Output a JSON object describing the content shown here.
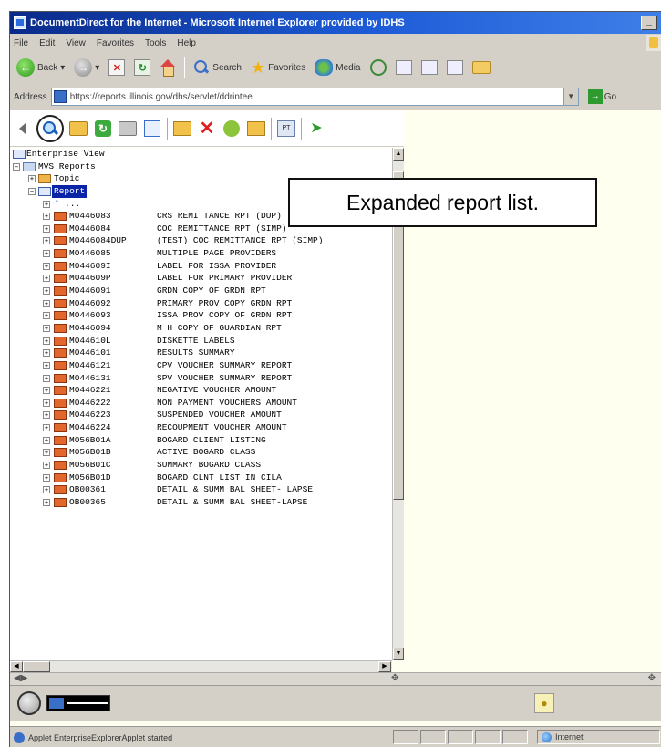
{
  "window": {
    "title": "DocumentDirect for the Internet - Microsoft Internet Explorer provided by IDHS",
    "min_glyph": "_"
  },
  "menubar": [
    "File",
    "Edit",
    "View",
    "Favorites",
    "Tools",
    "Help"
  ],
  "toolbar": {
    "back": "Back",
    "search": "Search",
    "favorites": "Favorites",
    "media": "Media"
  },
  "address": {
    "label": "Address",
    "url": "https://reports.illinois.gov/dhs/servlet/ddrintee",
    "go": "Go"
  },
  "callout": "Expanded report list.",
  "tree": {
    "root": "Enterprise View",
    "mvs": "MVS Reports",
    "topic": "Topic",
    "report": "Report",
    "up": "...",
    "reports": [
      {
        "id": "M0446083",
        "name": "CRS REMITTANCE RPT (DUP)"
      },
      {
        "id": "M0446084",
        "name": "COC REMITTANCE RPT (SIMP)"
      },
      {
        "id": "M0446084DUP",
        "name": "(TEST) COC REMITTANCE RPT (SIMP)"
      },
      {
        "id": "M0446085",
        "name": "MULTIPLE PAGE PROVIDERS"
      },
      {
        "id": "M044609I",
        "name": "LABEL FOR ISSA PROVIDER"
      },
      {
        "id": "M044609P",
        "name": "LABEL FOR PRIMARY PROVIDER"
      },
      {
        "id": "M0446091",
        "name": "GRDN COPY OF GRDN RPT"
      },
      {
        "id": "M0446092",
        "name": "PRIMARY PROV COPY GRDN RPT"
      },
      {
        "id": "M0446093",
        "name": "ISSA PROV COPY OF GRDN RPT"
      },
      {
        "id": "M0446094",
        "name": "M H COPY OF GUARDIAN RPT"
      },
      {
        "id": "M044610L",
        "name": "DISKETTE LABELS"
      },
      {
        "id": "M0446101",
        "name": "RESULTS SUMMARY"
      },
      {
        "id": "M0446121",
        "name": "CPV VOUCHER SUMMARY REPORT"
      },
      {
        "id": "M0446131",
        "name": "SPV VOUCHER SUMMARY REPORT"
      },
      {
        "id": "M0446221",
        "name": "NEGATIVE VOUCHER AMOUNT"
      },
      {
        "id": "M0446222",
        "name": "NON PAYMENT VOUCHERS AMOUNT"
      },
      {
        "id": "M0446223",
        "name": "SUSPENDED VOUCHER AMOUNT"
      },
      {
        "id": "M0446224",
        "name": "RECOUPMENT VOUCHER AMOUNT"
      },
      {
        "id": "M056B01A",
        "name": "BOGARD CLIENT LISTING"
      },
      {
        "id": "M056B01B",
        "name": "ACTIVE BOGARD CLASS"
      },
      {
        "id": "M056B01C",
        "name": "SUMMARY BOGARD CLASS"
      },
      {
        "id": "M056B01D",
        "name": "BOGARD CLNT LIST IN CILA"
      },
      {
        "id": "OB00361",
        "name": "DETAIL & SUMM BAL SHEET- LAPSE"
      },
      {
        "id": "OB00365",
        "name": "DETAIL & SUMM BAL SHEET-LAPSE"
      }
    ]
  },
  "status": {
    "text": "Applet EnterpriseExplorerApplet started",
    "zone": "Internet"
  }
}
